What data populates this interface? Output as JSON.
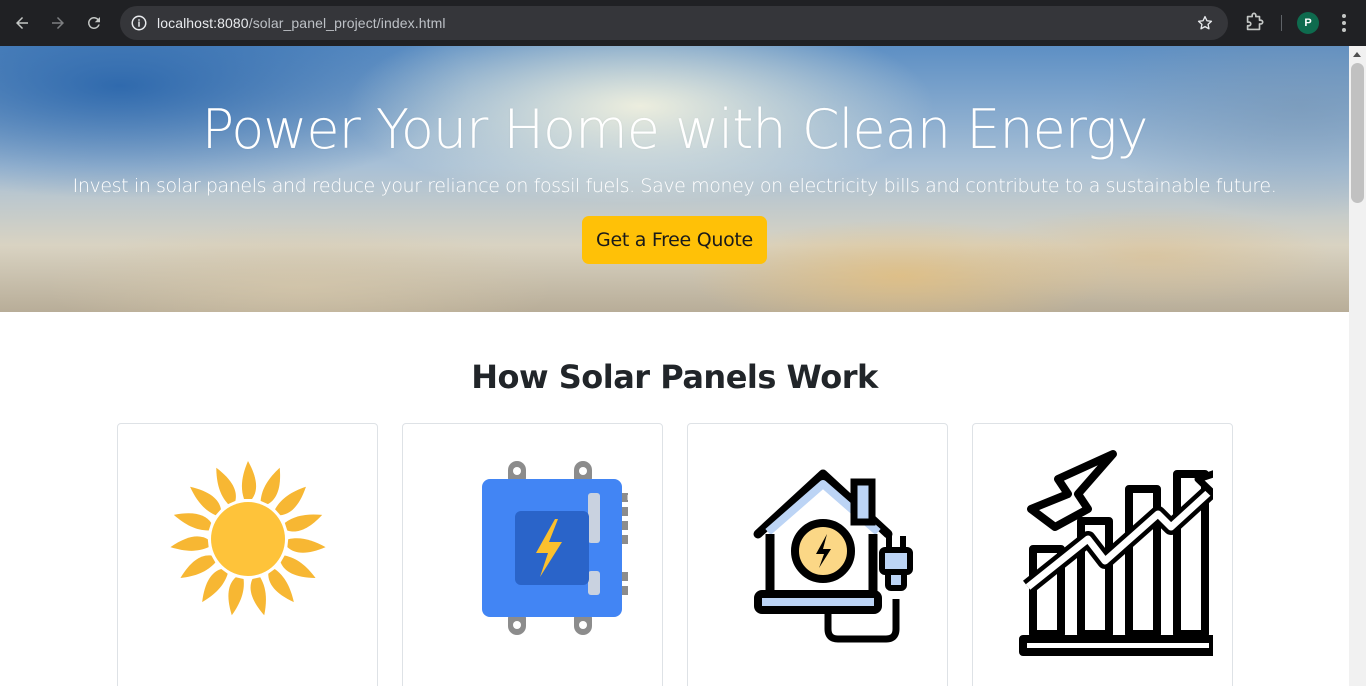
{
  "browser": {
    "url_host": "localhost:8080",
    "url_path": "/solar_panel_project/index.html",
    "profile_initial": "P"
  },
  "hero": {
    "title": "Power Your Home with Clean Energy",
    "subtitle": "Invest in solar panels and reduce your reliance on fossil fuels. Save money on electricity bills and contribute to a sustainable future.",
    "cta_label": "Get a Free Quote"
  },
  "section": {
    "title": "How Solar Panels Work",
    "cards": [
      {
        "icon": "sun-icon"
      },
      {
        "icon": "inverter-icon"
      },
      {
        "icon": "house-plug-icon"
      },
      {
        "icon": "growth-chart-icon"
      }
    ]
  },
  "colors": {
    "cta": "#ffc107",
    "chrome": "#202124"
  }
}
